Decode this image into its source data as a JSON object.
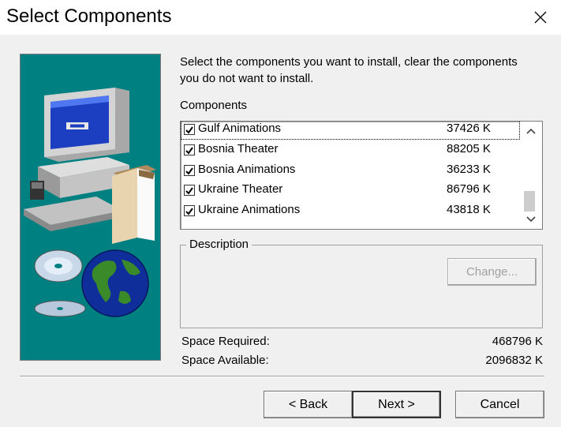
{
  "window": {
    "title": "Select Components"
  },
  "instructions": {
    "line1": "Select the components you want to install, clear the components",
    "line2": "you do not want to install."
  },
  "components": {
    "label": "Components",
    "items": [
      {
        "name": "Gulf Animations",
        "size": "37426 K",
        "checked": true
      },
      {
        "name": "Bosnia Theater",
        "size": "88205 K",
        "checked": true
      },
      {
        "name": "Bosnia Animations",
        "size": "36233 K",
        "checked": true
      },
      {
        "name": "Ukraine Theater",
        "size": "86796 K",
        "checked": true
      },
      {
        "name": "Ukraine Animations",
        "size": "43818 K",
        "checked": true
      }
    ]
  },
  "description": {
    "label": "Description",
    "change_button": "Change..."
  },
  "space": {
    "required_label": "Space Required:",
    "required_value": "468796 K",
    "available_label": "Space Available:",
    "available_value": "2096832 K"
  },
  "buttons": {
    "back": "< Back",
    "next": "Next >",
    "cancel": "Cancel"
  },
  "colors": {
    "art_background": "#008080",
    "title_bar": "#ffffff",
    "dialog": "#f0f0f0"
  }
}
